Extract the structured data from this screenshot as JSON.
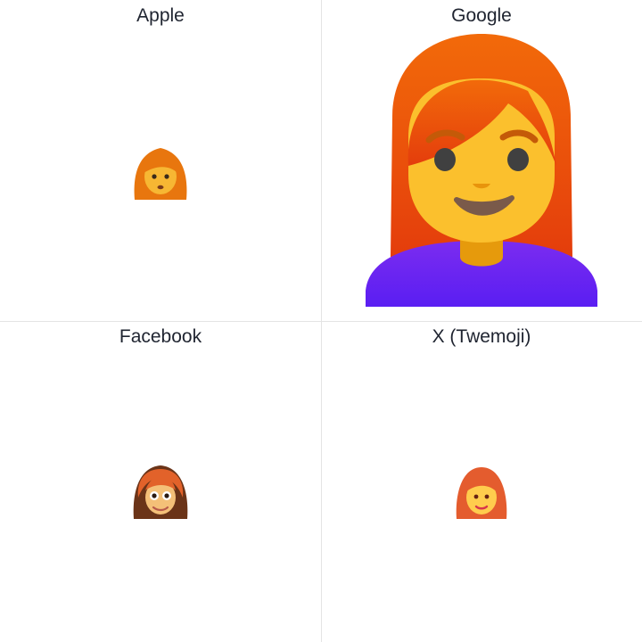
{
  "cells": [
    {
      "vendor": "Apple",
      "icon": "woman-red-hair-icon"
    },
    {
      "vendor": "Google",
      "icon": "woman-red-hair-icon"
    },
    {
      "vendor": "Facebook",
      "icon": "woman-red-hair-icon"
    },
    {
      "vendor": "X (Twemoji)",
      "icon": "woman-red-hair-icon"
    }
  ],
  "colors": {
    "divider": "#e4e4e4",
    "label_text": "#1f2430",
    "skin": "#fbc02d",
    "red_hair": "#e8470e",
    "shirt": "#6520f5"
  }
}
